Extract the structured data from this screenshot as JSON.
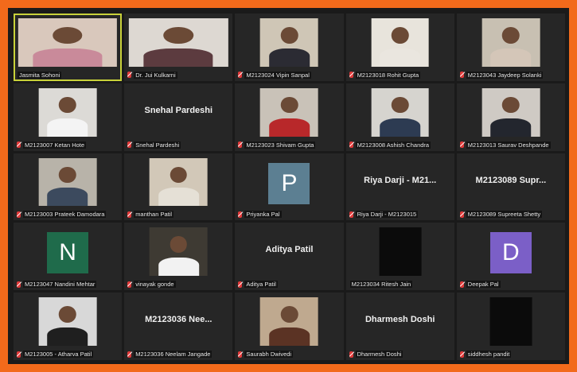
{
  "tiles": [
    {
      "label": "Jasmita Sohoni",
      "kind": "video",
      "muted": false,
      "active": true
    },
    {
      "label": "Dr. Jui Kulkarni",
      "kind": "video",
      "muted": true,
      "active": false
    },
    {
      "label": "M2123024 Vipin Sanpal",
      "kind": "video",
      "muted": true,
      "active": false
    },
    {
      "label": "M2123018 Rohit Gupta",
      "kind": "video",
      "muted": true,
      "active": false
    },
    {
      "label": "M2123043 Jaydeep Solanki",
      "kind": "video",
      "muted": true,
      "active": false
    },
    {
      "label": "M2123007 Ketan Hote",
      "kind": "video",
      "muted": true,
      "active": false
    },
    {
      "label": "Snehal Pardeshi",
      "kind": "name",
      "display_name": "Snehal Pardeshi",
      "muted": true,
      "active": false
    },
    {
      "label": "M2123023 Shivam Gupta",
      "kind": "video",
      "muted": true,
      "active": false
    },
    {
      "label": "M2123008 Ashish Chandra",
      "kind": "video",
      "muted": true,
      "active": false
    },
    {
      "label": "M2123013 Saurav Deshpande",
      "kind": "video",
      "muted": true,
      "active": false
    },
    {
      "label": "M2123003 Prateek Damodara",
      "kind": "video",
      "muted": true,
      "active": false
    },
    {
      "label": "manthan Patil",
      "kind": "video",
      "muted": true,
      "active": false
    },
    {
      "label": "Priyanka Pal",
      "kind": "avatar",
      "initial": "P",
      "avatar_color": "#5c7f92",
      "muted": true,
      "active": false
    },
    {
      "label": "Riya Darji - M2123015",
      "kind": "name",
      "display_name": "Riya Darji - M21...",
      "muted": true,
      "active": false
    },
    {
      "label": "M2123089 Supreeta Shetty",
      "kind": "name",
      "display_name": "M2123089 Supr...",
      "muted": true,
      "active": false
    },
    {
      "label": "M2123047 Nandini Mehtar",
      "kind": "avatar",
      "initial": "N",
      "avatar_color": "#1f6b4b",
      "muted": true,
      "active": false
    },
    {
      "label": "vinayak gonde",
      "kind": "video",
      "muted": true,
      "active": false
    },
    {
      "label": "Aditya Patil",
      "kind": "name",
      "display_name": "Aditya Patil",
      "muted": true,
      "active": false
    },
    {
      "label": "M2123034 Ritesh Jain",
      "kind": "dark",
      "muted": false,
      "active": false
    },
    {
      "label": "Deepak Pal",
      "kind": "avatar",
      "initial": "D",
      "avatar_color": "#7b5fc7",
      "muted": true,
      "active": false
    },
    {
      "label": "M2123005 - Atharva Patil",
      "kind": "video",
      "muted": true,
      "active": false
    },
    {
      "label": "M2123036 Neelam Jangade",
      "kind": "name",
      "display_name": "M2123036 Nee...",
      "muted": true,
      "active": false
    },
    {
      "label": "Saurabh Dwivedi",
      "kind": "video",
      "muted": true,
      "active": false
    },
    {
      "label": "Dharmesh Doshi",
      "kind": "name",
      "display_name": "Dharmesh Doshi",
      "muted": true,
      "active": false
    },
    {
      "label": "siddhesh pandit",
      "kind": "dark",
      "muted": true,
      "active": false
    }
  ]
}
